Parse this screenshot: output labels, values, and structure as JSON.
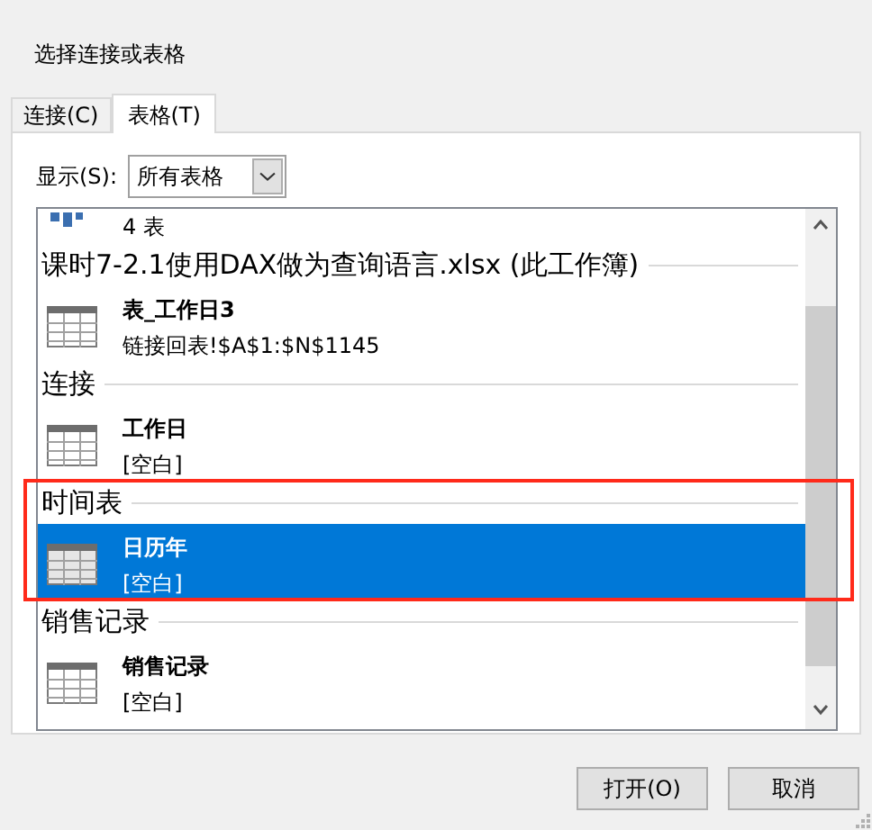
{
  "window": {
    "title": "选择连接或表格"
  },
  "tabs": [
    {
      "label": "连接(C)",
      "selected": false
    },
    {
      "label": "表格(T)",
      "selected": true
    }
  ],
  "show_filter": {
    "label": "显示(S):",
    "value": "所有表格"
  },
  "list": [
    {
      "kind": "partial_item",
      "subtitle": "4 表",
      "selected": false
    },
    {
      "kind": "header",
      "label": "课时7-2.1使用DAX做为查询语言.xlsx (此工作簿)"
    },
    {
      "kind": "item",
      "title": "表_工作日3",
      "subtitle": "链接回表!$A$1:$N$1145",
      "selected": false
    },
    {
      "kind": "header",
      "label": "连接"
    },
    {
      "kind": "item",
      "title": "工作日",
      "subtitle": "[空白]",
      "selected": false
    },
    {
      "kind": "header",
      "label": "时间表"
    },
    {
      "kind": "item",
      "title": "日历年",
      "subtitle": "[空白]",
      "selected": true
    },
    {
      "kind": "header",
      "label": "销售记录"
    },
    {
      "kind": "item",
      "title": "销售记录",
      "subtitle": "[空白]",
      "selected": false
    }
  ],
  "buttons": [
    "打开(O)",
    "取消"
  ]
}
